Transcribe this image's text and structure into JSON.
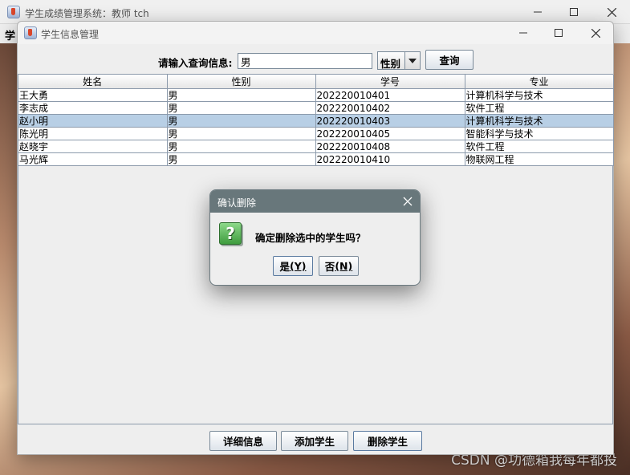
{
  "main_window": {
    "title": "学生成绩管理系统：教师 tch",
    "menu_label": "学"
  },
  "info_window": {
    "title": "学生信息管理",
    "search": {
      "label": "请输入查询信息:",
      "value": "男",
      "field": "性别",
      "query_button": "查询"
    },
    "table": {
      "columns": [
        "姓名",
        "性别",
        "学号",
        "专业"
      ],
      "rows": [
        [
          "王大勇",
          "男",
          "202220010401",
          "计算机科学与技术"
        ],
        [
          "李志成",
          "男",
          "202220010402",
          "软件工程"
        ],
        [
          "赵小明",
          "男",
          "202220010403",
          "计算机科学与技术"
        ],
        [
          "陈光明",
          "男",
          "202220010405",
          "智能科学与技术"
        ],
        [
          "赵晓宇",
          "男",
          "202220010408",
          "软件工程"
        ],
        [
          "马光辉",
          "男",
          "202220010410",
          "物联网工程"
        ]
      ],
      "selected_row": 2
    },
    "buttons": {
      "detail": "详细信息",
      "add": "添加学生",
      "delete": "删除学生"
    }
  },
  "dialog": {
    "title": "确认删除",
    "message": "确定删除选中的学生吗？",
    "yes_label": "是",
    "yes_mnemonic": "(Y)",
    "no_label": "否",
    "no_mnemonic": "(N)"
  },
  "watermark": "CSDN @功德箱我每年都投",
  "colors": {
    "selected_row": "#b8cfe5",
    "dialog_titlebar": "#68777b",
    "question_icon": "#3e9c3e"
  }
}
